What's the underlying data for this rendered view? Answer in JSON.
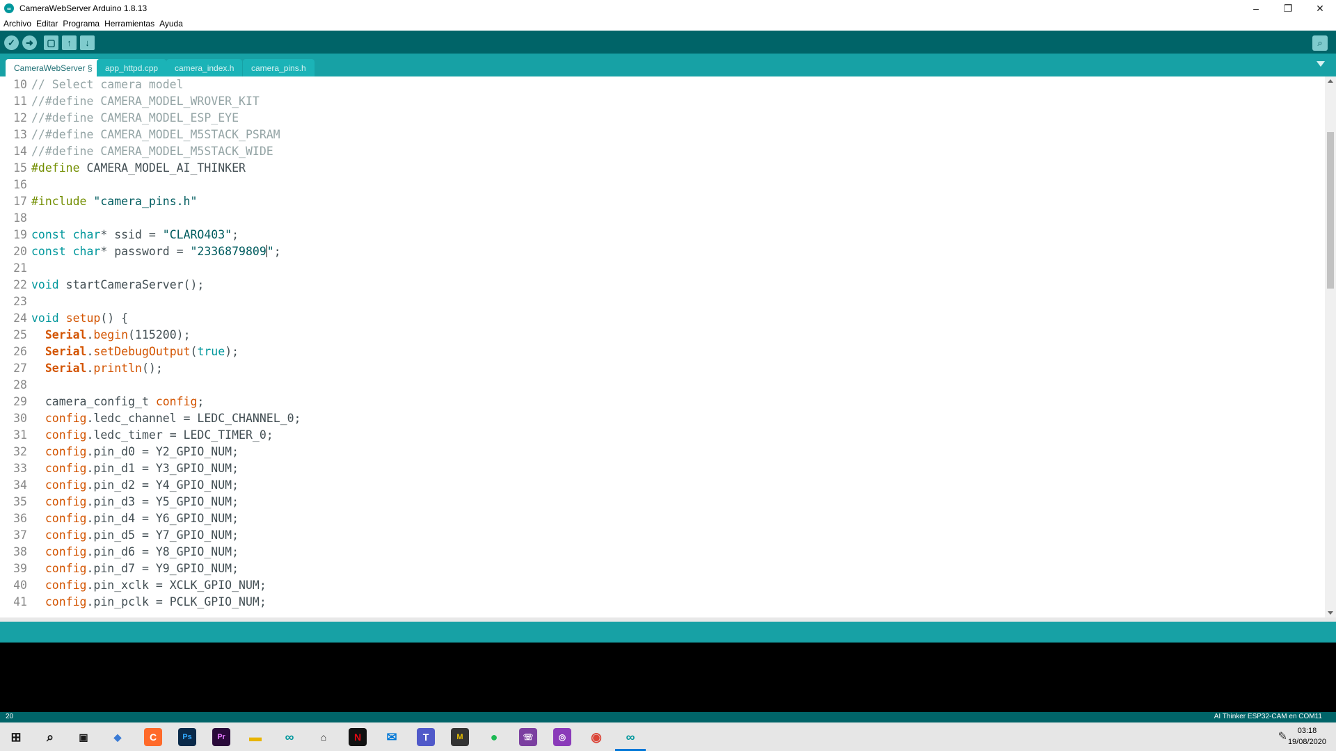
{
  "window": {
    "title": "CameraWebServer Arduino 1.8.13",
    "min": "–",
    "restore": "❐",
    "close": "✕"
  },
  "menu": [
    "Archivo",
    "Editar",
    "Programa",
    "Herramientas",
    "Ayuda"
  ],
  "toolbar": {
    "verify_icon": "check-icon",
    "upload_icon": "arrow-right-icon",
    "new_icon": "new-file-icon",
    "open_icon": "open-icon",
    "save_icon": "save-icon",
    "serial_monitor_icon": "magnifier-icon"
  },
  "tabs": [
    "CameraWebServer §",
    "app_httpd.cpp",
    "camera_index.h",
    "camera_pins.h"
  ],
  "editor": {
    "lines": [
      {
        "n": "10",
        "t": "// Select camera model"
      },
      {
        "n": "11",
        "t": "//#define CAMERA_MODEL_WROVER_KIT"
      },
      {
        "n": "12",
        "t": "//#define CAMERA_MODEL_ESP_EYE"
      },
      {
        "n": "13",
        "t": "//#define CAMERA_MODEL_M5STACK_PSRAM"
      },
      {
        "n": "14",
        "t": "//#define CAMERA_MODEL_M5STACK_WIDE"
      },
      {
        "n": "15",
        "t": "#define CAMERA_MODEL_AI_THINKER"
      },
      {
        "n": "16",
        "t": ""
      },
      {
        "n": "17",
        "t": "#include \"camera_pins.h\""
      },
      {
        "n": "18",
        "t": ""
      },
      {
        "n": "19",
        "t": "const char* ssid = \"CLARO403\";"
      },
      {
        "n": "20",
        "t": "const char* password = \"2336879809\";"
      },
      {
        "n": "21",
        "t": ""
      },
      {
        "n": "22",
        "t": "void startCameraServer();"
      },
      {
        "n": "23",
        "t": ""
      },
      {
        "n": "24",
        "t": "void setup() {"
      },
      {
        "n": "25",
        "t": "  Serial.begin(115200);"
      },
      {
        "n": "26",
        "t": "  Serial.setDebugOutput(true);"
      },
      {
        "n": "27",
        "t": "  Serial.println();"
      },
      {
        "n": "28",
        "t": ""
      },
      {
        "n": "29",
        "t": "  camera_config_t config;"
      },
      {
        "n": "30",
        "t": "  config.ledc_channel = LEDC_CHANNEL_0;"
      },
      {
        "n": "31",
        "t": "  config.ledc_timer = LEDC_TIMER_0;"
      },
      {
        "n": "32",
        "t": "  config.pin_d0 = Y2_GPIO_NUM;"
      },
      {
        "n": "33",
        "t": "  config.pin_d1 = Y3_GPIO_NUM;"
      },
      {
        "n": "34",
        "t": "  config.pin_d2 = Y4_GPIO_NUM;"
      },
      {
        "n": "35",
        "t": "  config.pin_d3 = Y5_GPIO_NUM;"
      },
      {
        "n": "36",
        "t": "  config.pin_d4 = Y6_GPIO_NUM;"
      },
      {
        "n": "37",
        "t": "  config.pin_d5 = Y7_GPIO_NUM;"
      },
      {
        "n": "38",
        "t": "  config.pin_d6 = Y8_GPIO_NUM;"
      },
      {
        "n": "39",
        "t": "  config.pin_d7 = Y9_GPIO_NUM;"
      },
      {
        "n": "40",
        "t": "  config.pin_xclk = XCLK_GPIO_NUM;"
      },
      {
        "n": "41",
        "t": "  config.pin_pclk = PCLK_GPIO_NUM;"
      }
    ]
  },
  "status": {
    "line": "20",
    "board": "AI Thinker ESP32-CAM en COM11"
  },
  "taskbar": {
    "icons": [
      "windows-start-icon",
      "search-icon",
      "task-view-icon",
      "app-icon",
      "app-icon",
      "photoshop-icon",
      "premiere-icon",
      "file-explorer-icon",
      "arduino-icon",
      "store-icon",
      "netflix-icon",
      "mail-icon",
      "teams-icon",
      "app-icon",
      "spotify-icon",
      "whatsapp-icon",
      "instagram-icon",
      "chrome-icon",
      "arduino-icon"
    ],
    "time": "03:18",
    "date": "19/08/2020"
  },
  "colors": {
    "toolbar_bg": "#006468",
    "tabbar_bg": "#17a1a5",
    "accent": "#00979c"
  }
}
